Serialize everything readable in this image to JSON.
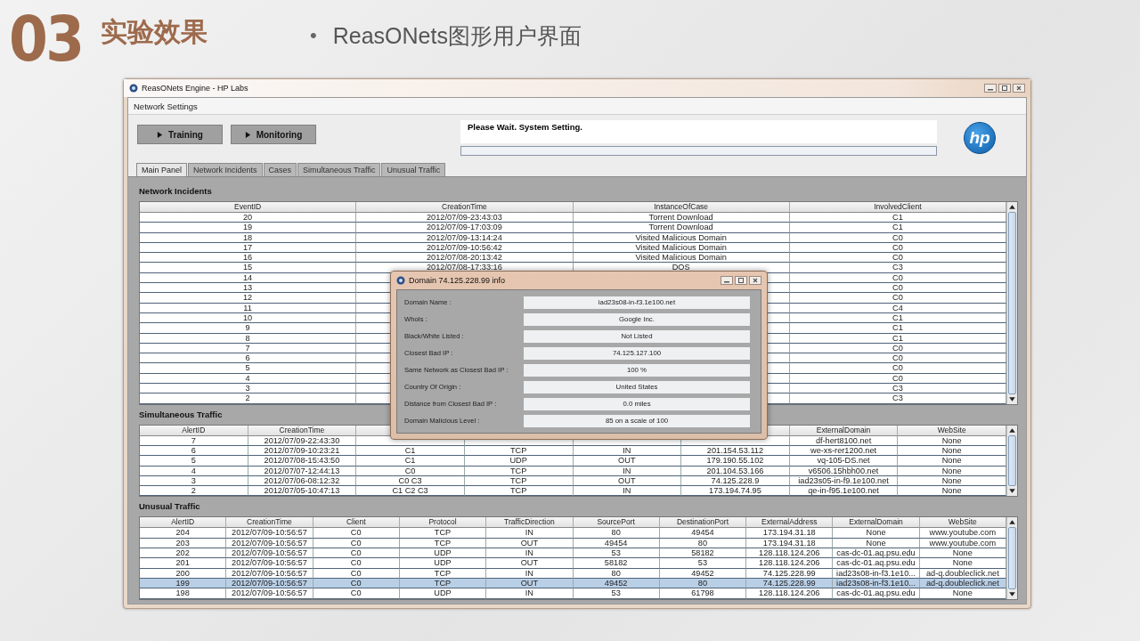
{
  "slide": {
    "number": "03",
    "title": "实验效果",
    "bullet": "•",
    "subtitle": "ReasONets图形用户界面"
  },
  "window": {
    "title": "ReasONets Engine - HP Labs"
  },
  "menu": [
    "Network Settings"
  ],
  "buttons": [
    "Training",
    "Monitoring"
  ],
  "status": {
    "message": "Please Wait. System Setting.",
    "level": 0
  },
  "logo": {
    "text": "hp"
  },
  "tabs": [
    {
      "label": "Main Panel",
      "selected": true
    },
    {
      "label": "Network Incidents",
      "selected": false
    },
    {
      "label": "Cases",
      "selected": false
    },
    {
      "label": "Simultaneous Traffic",
      "selected": false
    },
    {
      "label": "Unusual Traffic",
      "selected": false
    }
  ],
  "panels": [
    {
      "title": "Network Incidents",
      "columns": [
        "EventID",
        "CreationTime",
        "InstanceOfCase",
        "InvolvedClient"
      ],
      "rows": [
        {
          "cells": [
            "20",
            "2012/07/09-23:43:03",
            "Torrent Download",
            "C1"
          ],
          "selected": false
        },
        {
          "cells": [
            "19",
            "2012/07/09-17:03:09",
            "Torrent Download",
            "C1"
          ],
          "selected": false
        },
        {
          "cells": [
            "18",
            "2012/07/09-13:14:24",
            "Visited Malicious Domain",
            "C0"
          ],
          "selected": false
        },
        {
          "cells": [
            "17",
            "2012/07/09-10:56:42",
            "Visited Malicious Domain",
            "C0"
          ],
          "selected": false
        },
        {
          "cells": [
            "16",
            "2012/07/08-20:13:42",
            "Visited Malicious Domain",
            "C0"
          ],
          "selected": false
        },
        {
          "cells": [
            "15",
            "2012/07/08-17:33:16",
            "DOS",
            "C3"
          ],
          "selected": false
        },
        {
          "cells": [
            "14",
            null,
            null,
            "C0"
          ],
          "selected": false
        },
        {
          "cells": [
            "13",
            null,
            null,
            "C0"
          ],
          "selected": false
        },
        {
          "cells": [
            "12",
            null,
            null,
            "C0"
          ],
          "selected": false
        },
        {
          "cells": [
            "11",
            null,
            null,
            "C4"
          ],
          "selected": false
        },
        {
          "cells": [
            "10",
            null,
            null,
            "C1"
          ],
          "selected": false
        },
        {
          "cells": [
            "9",
            null,
            null,
            "C1"
          ],
          "selected": false
        },
        {
          "cells": [
            "8",
            null,
            null,
            "C1"
          ],
          "selected": false
        },
        {
          "cells": [
            "7",
            null,
            null,
            "C0"
          ],
          "selected": false
        },
        {
          "cells": [
            "6",
            null,
            null,
            "C0"
          ],
          "selected": false
        },
        {
          "cells": [
            "5",
            null,
            null,
            "C0"
          ],
          "selected": false
        },
        {
          "cells": [
            "4",
            null,
            null,
            "C0"
          ],
          "selected": false
        },
        {
          "cells": [
            "3",
            null,
            null,
            "C3"
          ],
          "selected": false
        },
        {
          "cells": [
            "2",
            null,
            null,
            "C3"
          ],
          "selected": false
        }
      ]
    },
    {
      "title": "Simultaneous Traffic",
      "columns": [
        "AlertID",
        "CreationTime",
        null,
        null,
        null,
        null,
        "ExternalDomain",
        "WebSite"
      ],
      "rows": [
        {
          "cells": [
            "7",
            "2012/07/09-22:43:30",
            null,
            null,
            null,
            null,
            "df-hert8100.net",
            "None"
          ],
          "selected": false
        },
        {
          "cells": [
            "6",
            "2012/07/09-10:23:21",
            "C1",
            "TCP",
            "IN",
            "201.154.53.112",
            "we-xs-rer1200.net",
            "None"
          ],
          "selected": false
        },
        {
          "cells": [
            "5",
            "2012/07/08-15:43:50",
            "C1",
            "UDP",
            "OUT",
            "179.190.55.102",
            "vq-105-DS.net",
            "None"
          ],
          "selected": false
        },
        {
          "cells": [
            "4",
            "2012/07/07-12:44:13",
            "C0",
            "TCP",
            "IN",
            "201.104.53.166",
            "v6506.15hbh00.net",
            "None"
          ],
          "selected": false
        },
        {
          "cells": [
            "3",
            "2012/07/06-08:12:32",
            "C0 C3",
            "TCP",
            "OUT",
            "74.125.228.9",
            "iad23s05-in-f9.1e100.net",
            "None"
          ],
          "selected": false
        },
        {
          "cells": [
            "2",
            "2012/07/05-10:47:13",
            "C1 C2 C3",
            "TCP",
            "IN",
            "173.194.74.95",
            "qe-in-f95.1e100.net",
            "None"
          ],
          "selected": false
        }
      ]
    },
    {
      "title": "Unusual Traffic",
      "columns": [
        "AlertID",
        "CreationTime",
        "Client",
        "Protocol",
        "TrafficDirection",
        "SourcePort",
        "DestinationPort",
        "ExternalAddress",
        "ExternalDomain",
        "WebSite"
      ],
      "rows": [
        {
          "cells": [
            "204",
            "2012/07/09-10:56:57",
            "C0",
            "TCP",
            "IN",
            "80",
            "49454",
            "173.194.31.18",
            "None",
            "www.youtube.com"
          ],
          "selected": false
        },
        {
          "cells": [
            "203",
            "2012/07/09-10:56:57",
            "C0",
            "TCP",
            "OUT",
            "49454",
            "80",
            "173.194.31.18",
            "None",
            "www.youtube.com"
          ],
          "selected": false
        },
        {
          "cells": [
            "202",
            "2012/07/09-10:56:57",
            "C0",
            "UDP",
            "IN",
            "53",
            "58182",
            "128.118.124.206",
            "cas-dc-01.aq.psu.edu",
            "None"
          ],
          "selected": false
        },
        {
          "cells": [
            "201",
            "2012/07/09-10:56:57",
            "C0",
            "UDP",
            "OUT",
            "58182",
            "53",
            "128.118.124.206",
            "cas-dc-01.aq.psu.edu",
            "None"
          ],
          "selected": false
        },
        {
          "cells": [
            "200",
            "2012/07/09-10:56:57",
            "C0",
            "TCP",
            "IN",
            "80",
            "49452",
            "74.125.228.99",
            "iad23s08-in-f3.1e10...",
            "ad-q.doubleclick.net"
          ],
          "selected": false
        },
        {
          "cells": [
            "199",
            "2012/07/09-10:56:57",
            "C0",
            "TCP",
            "OUT",
            "49452",
            "80",
            "74.125.228.99",
            "iad23s08-in-f3.1e10...",
            "ad-q.doubleclick.net"
          ],
          "selected": true
        },
        {
          "cells": [
            "198",
            "2012/07/09-10:56:57",
            "C0",
            "UDP",
            "IN",
            "53",
            "61798",
            "128.118.124.206",
            "cas-dc-01.aq.psu.edu",
            "None"
          ],
          "selected": false
        }
      ]
    }
  ],
  "dialog": {
    "title": "Domain 74.125.228.99 info",
    "fields": [
      {
        "label": "Domain Name :",
        "value": "iad23s08-in-f3.1e100.net"
      },
      {
        "label": "WhoIs :",
        "value": "Google Inc."
      },
      {
        "label": "Black/White Listed :",
        "value": "Not Listed"
      },
      {
        "label": "Closest Bad IP :",
        "value": "74.125.127.100"
      },
      {
        "label": "Same Network as Closest Bad IP :",
        "value": "100 %"
      },
      {
        "label": "Country Of Origin :",
        "value": "United States"
      },
      {
        "label": "Distance from Closest Bad IP :",
        "value": "0.0 miles"
      },
      {
        "label": "Domain Malicious Level :",
        "value": "85 on a scale of 100"
      }
    ]
  }
}
